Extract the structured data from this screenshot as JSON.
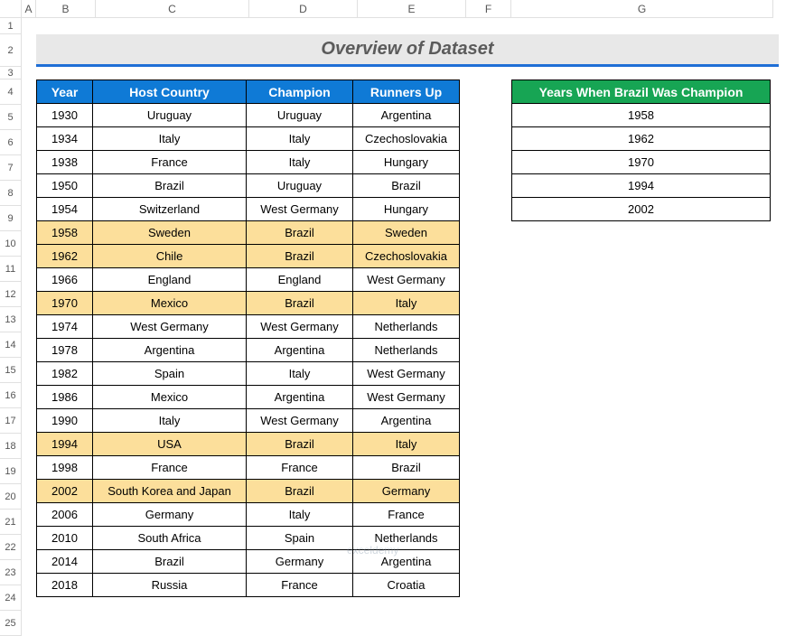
{
  "title": "Overview of Dataset",
  "columns": {
    "letters": [
      "A",
      "B",
      "C",
      "D",
      "E",
      "F",
      "G"
    ],
    "widths": [
      24,
      16,
      66,
      170,
      120,
      120,
      50,
      290
    ]
  },
  "rows": {
    "labels": [
      "1",
      "2",
      "3",
      "4",
      "5",
      "6",
      "7",
      "8",
      "9",
      "10",
      "11",
      "12",
      "13",
      "14",
      "15",
      "16",
      "17",
      "18",
      "19",
      "20",
      "21",
      "22",
      "23",
      "24",
      "25"
    ]
  },
  "main_table": {
    "headers": [
      "Year",
      "Host Country",
      "Champion",
      "Runners Up"
    ],
    "rows": [
      {
        "year": "1930",
        "host": "Uruguay",
        "champ": "Uruguay",
        "run": "Argentina",
        "hl": false
      },
      {
        "year": "1934",
        "host": "Italy",
        "champ": "Italy",
        "run": "Czechoslovakia",
        "hl": false
      },
      {
        "year": "1938",
        "host": "France",
        "champ": "Italy",
        "run": "Hungary",
        "hl": false
      },
      {
        "year": "1950",
        "host": "Brazil",
        "champ": "Uruguay",
        "run": "Brazil",
        "hl": false
      },
      {
        "year": "1954",
        "host": "Switzerland",
        "champ": "West Germany",
        "run": "Hungary",
        "hl": false
      },
      {
        "year": "1958",
        "host": "Sweden",
        "champ": "Brazil",
        "run": "Sweden",
        "hl": true
      },
      {
        "year": "1962",
        "host": "Chile",
        "champ": "Brazil",
        "run": "Czechoslovakia",
        "hl": true
      },
      {
        "year": "1966",
        "host": "England",
        "champ": "England",
        "run": "West Germany",
        "hl": false
      },
      {
        "year": "1970",
        "host": "Mexico",
        "champ": "Brazil",
        "run": "Italy",
        "hl": true
      },
      {
        "year": "1974",
        "host": "West Germany",
        "champ": "West Germany",
        "run": "Netherlands",
        "hl": false
      },
      {
        "year": "1978",
        "host": "Argentina",
        "champ": "Argentina",
        "run": "Netherlands",
        "hl": false
      },
      {
        "year": "1982",
        "host": "Spain",
        "champ": "Italy",
        "run": "West Germany",
        "hl": false
      },
      {
        "year": "1986",
        "host": "Mexico",
        "champ": "Argentina",
        "run": "West Germany",
        "hl": false
      },
      {
        "year": "1990",
        "host": "Italy",
        "champ": "West Germany",
        "run": "Argentina",
        "hl": false
      },
      {
        "year": "1994",
        "host": "USA",
        "champ": "Brazil",
        "run": "Italy",
        "hl": true
      },
      {
        "year": "1998",
        "host": "France",
        "champ": "France",
        "run": "Brazil",
        "hl": false
      },
      {
        "year": "2002",
        "host": "South Korea and Japan",
        "champ": "Brazil",
        "run": "Germany",
        "hl": true
      },
      {
        "year": "2006",
        "host": "Germany",
        "champ": "Italy",
        "run": "France",
        "hl": false
      },
      {
        "year": "2010",
        "host": "South Africa",
        "champ": "Spain",
        "run": "Netherlands",
        "hl": false
      },
      {
        "year": "2014",
        "host": "Brazil",
        "champ": "Germany",
        "run": "Argentina",
        "hl": false
      },
      {
        "year": "2018",
        "host": "Russia",
        "champ": "France",
        "run": "Croatia",
        "hl": false
      }
    ]
  },
  "side_table": {
    "header": "Years When Brazil Was Champion",
    "rows": [
      "1958",
      "1962",
      "1970",
      "1994",
      "2002"
    ]
  },
  "watermark": "exceldemy"
}
